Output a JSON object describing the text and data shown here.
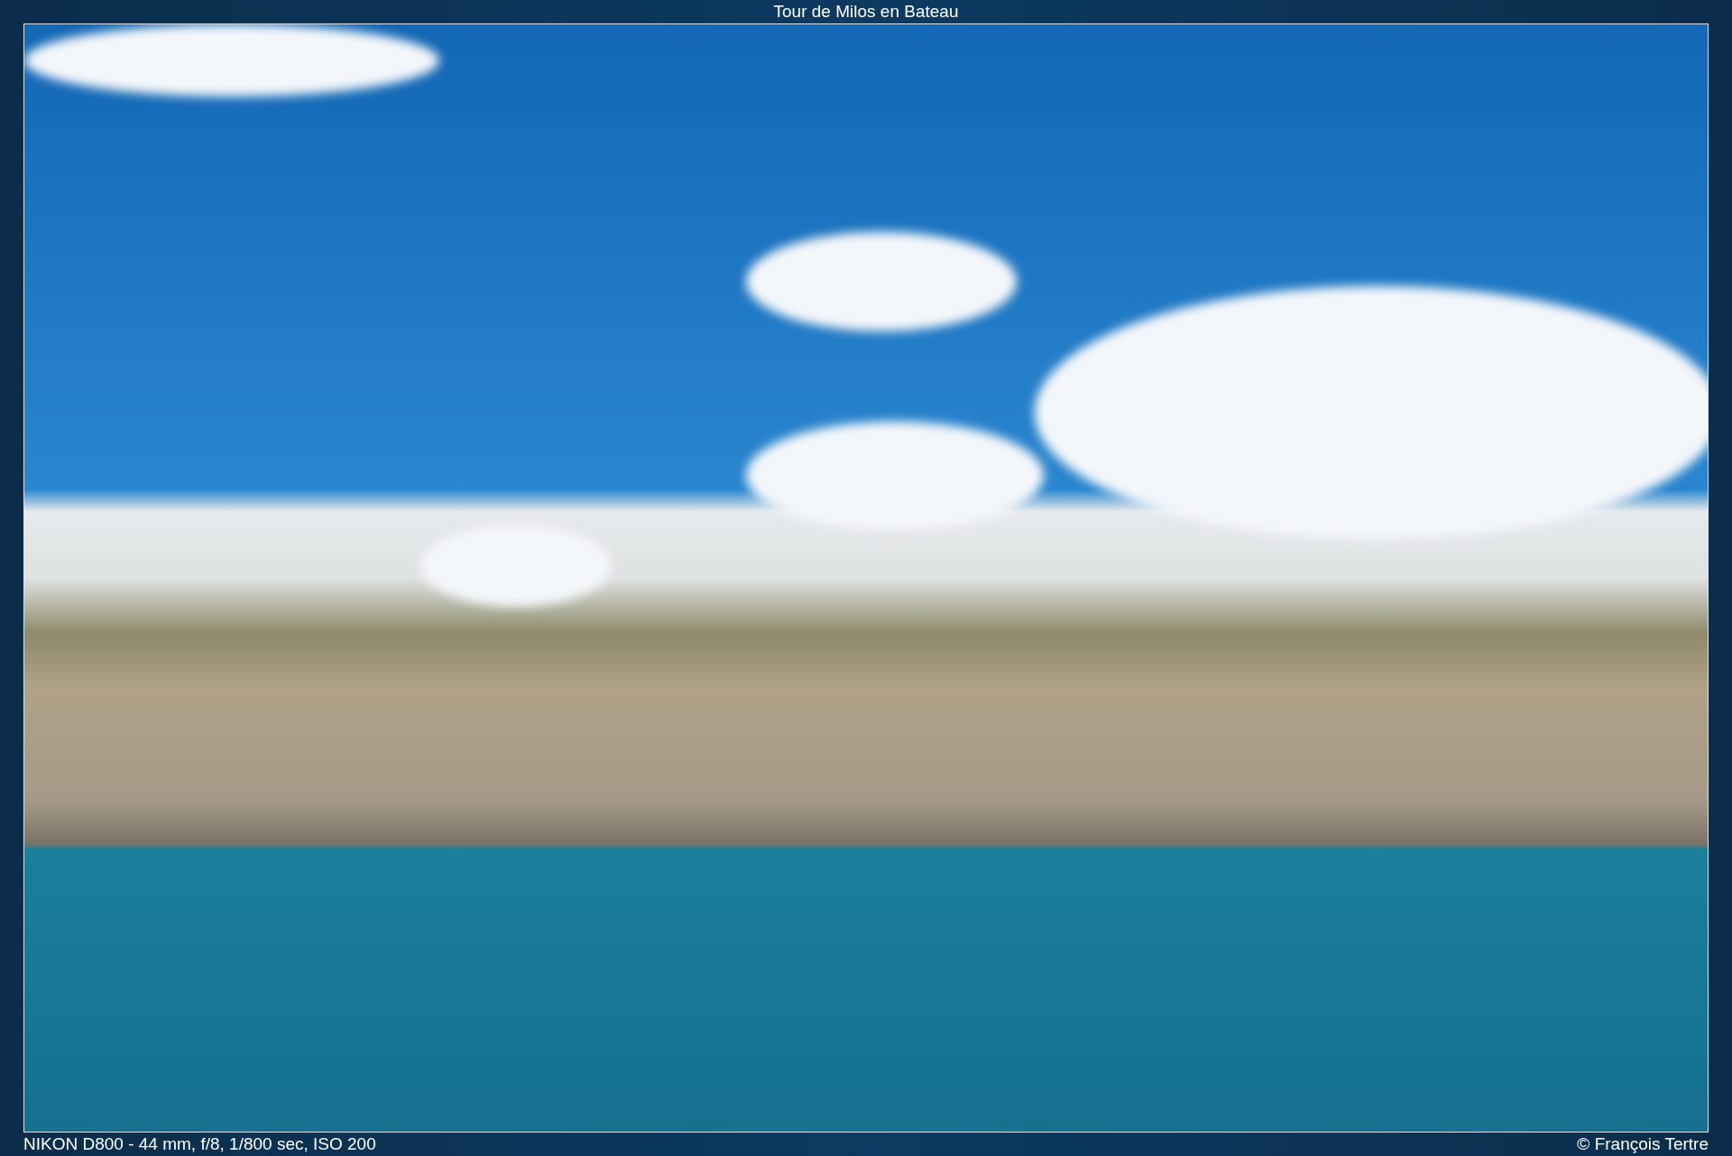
{
  "title": "Tour de Milos en Bateau",
  "photo": {
    "kind": "photo"
  },
  "caption": {
    "exif": "NIKON D800 - 44 mm, f/8, 1/800 sec, ISO 200",
    "credit": "© François Tertre"
  }
}
